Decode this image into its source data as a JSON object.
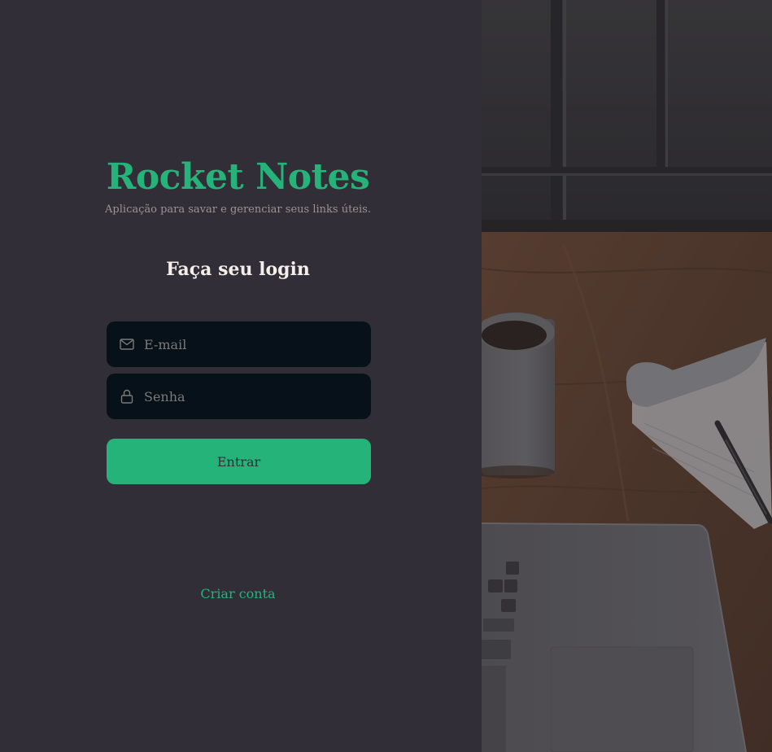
{
  "brand": {
    "title": "Rocket Notes",
    "subtitle": "Aplicação para savar e gerenciar seus links úteis."
  },
  "login": {
    "heading": "Faça seu login",
    "email_placeholder": "E-mail",
    "password_placeholder": "Senha",
    "submit_label": "Entrar",
    "create_account_label": "Criar conta"
  },
  "icons": {
    "email": "mail-icon",
    "password": "lock-icon"
  },
  "colors": {
    "background": "#312e38",
    "accent": "#26b37a",
    "input_background": "#07111a",
    "heading": "#f4ede8",
    "muted": "#999591"
  }
}
